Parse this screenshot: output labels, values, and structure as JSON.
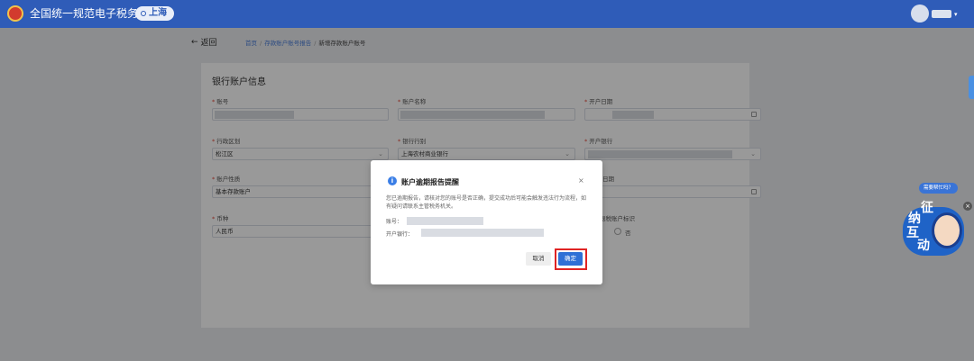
{
  "header": {
    "title": "全国统一规范电子税务局",
    "region": "上海"
  },
  "nav": {
    "back_label": "返回",
    "breadcrumb": [
      "首页",
      "存款账户账号报告",
      "新增存款账户账号"
    ]
  },
  "form": {
    "section_title": "银行账户信息",
    "fields": {
      "account_no": {
        "label": "账号"
      },
      "account_name": {
        "label": "账户名称"
      },
      "open_date": {
        "label": "开户日期"
      },
      "district": {
        "label": "行政区划",
        "value": "松江区"
      },
      "bank_type": {
        "label": "银行行别",
        "value": "上海农村商业银行"
      },
      "open_bank": {
        "label": "开户银行"
      },
      "account_nature": {
        "label": "账户性质",
        "value": "基本存款账户"
      },
      "date2": {
        "label": "日期"
      },
      "currency": {
        "label": "币种",
        "value": "人民币"
      },
      "tax_flag": {
        "label": "退税账户标识",
        "option_no": "否"
      }
    }
  },
  "dialog": {
    "title": "账户逾期报告提醒",
    "message": "您已逾期报告，请核对您的账号是否正确，提交成功后可能会触发违法行为流程，如有疑问请联系主管税务机关。",
    "account_label": "账号：",
    "bank_label": "开户银行：",
    "cancel_label": "取消",
    "confirm_label": "确定",
    "close_symbol": "×",
    "info_symbol": "i"
  },
  "assistant": {
    "bubble": "需要帮忙吗？",
    "chars": [
      "征",
      "纳",
      "互",
      "动"
    ]
  },
  "icons": {
    "back": "arrow-left-icon",
    "pin": "location-pin-icon",
    "calendar": "calendar-icon",
    "chevron": "chevron-down-icon",
    "info": "info-icon",
    "close": "close-icon"
  },
  "colors": {
    "header_bg": "#2f5cb8",
    "primary_button": "#2f6fd6",
    "highlight_box": "#e02424",
    "required_mark": "#e24a3b"
  }
}
